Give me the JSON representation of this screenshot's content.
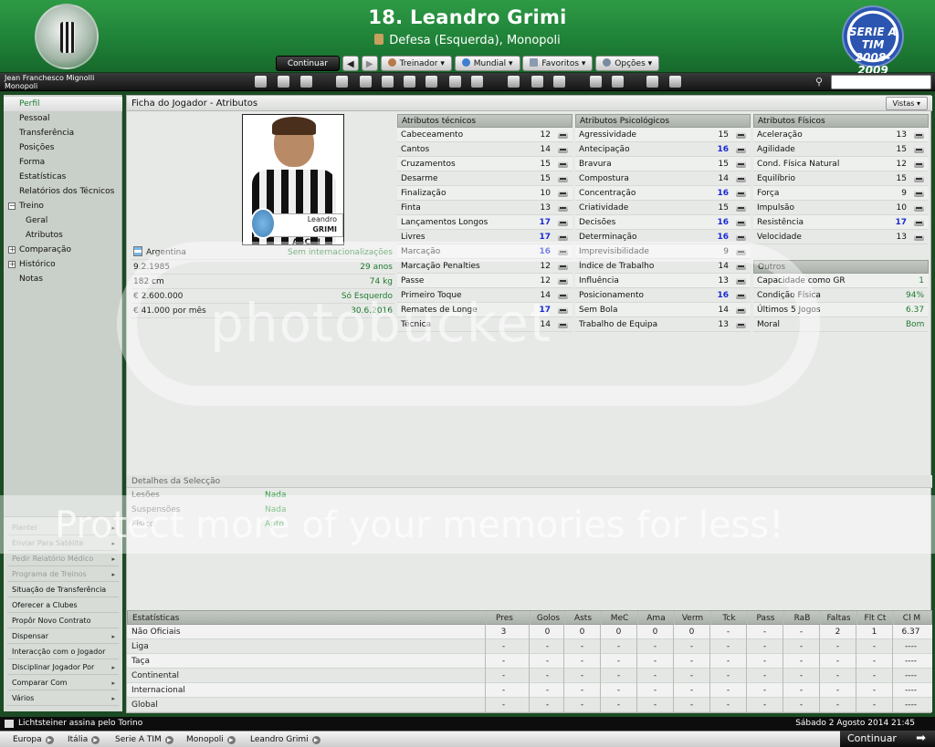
{
  "header": {
    "title": "18. Leandro Grimi",
    "subtitle": "Defesa (Esquerda), Monopoli",
    "continue_label": "Continuar",
    "menus": [
      "Treinador",
      "Mundial",
      "Favoritos",
      "Opções"
    ],
    "right_logo_text": "SERIE A TIM 2008-2009"
  },
  "manager": {
    "name": "Jean Franchesco Mignolli",
    "club": "Monopoli"
  },
  "search": {
    "placeholder": ""
  },
  "sidebar": {
    "items": [
      "Perfil",
      "Pessoal",
      "Transferência",
      "Posições",
      "Forma",
      "Estatísticas",
      "Relatórios dos Técnicos",
      "Treino",
      "Geral",
      "Atributos",
      "Comparação",
      "Histórico",
      "Notas"
    ],
    "actions": [
      "Plantel",
      "Enviar Para Satélite",
      "Pedir Relatório Médico",
      "Programa de Treinos",
      "Situação de Transferência",
      "Oferecer a Clubes",
      "Propôr Novo Contrato",
      "Dispensar",
      "Interacção com o Jogador",
      "Disciplinar Jogador Por",
      "Comparar Com",
      "Vários"
    ]
  },
  "panel": {
    "title": "Ficha do Jogador - Atributos",
    "views_label": "Vistas"
  },
  "player": {
    "card_first": "Leandro",
    "card_last": "GRIMI",
    "sponsor": "ASCHI",
    "nation": "Argentina",
    "internationals": "Sem internacionalizações",
    "dob": "9.2.1985",
    "age": "29 anos",
    "height": "182 cm",
    "weight": "74 kg",
    "value": "€ 2.600.000",
    "foot": "Só Esquerdo",
    "wage": "€ 41.000 por mês",
    "contract": "30.6.2016"
  },
  "technical": {
    "title": "Atributos técnicos",
    "rows": [
      {
        "name": "Cabeceamento",
        "value": "12"
      },
      {
        "name": "Cantos",
        "value": "14"
      },
      {
        "name": "Cruzamentos",
        "value": "15"
      },
      {
        "name": "Desarme",
        "value": "15"
      },
      {
        "name": "Finalização",
        "value": "10"
      },
      {
        "name": "Finta",
        "value": "13"
      },
      {
        "name": "Lançamentos Longos",
        "value": "17"
      },
      {
        "name": "Livres",
        "value": "17"
      },
      {
        "name": "Marcação",
        "value": "16"
      },
      {
        "name": "Marcação Penalties",
        "value": "12"
      },
      {
        "name": "Passe",
        "value": "12"
      },
      {
        "name": "Primeiro Toque",
        "value": "14"
      },
      {
        "name": "Remates de Longe",
        "value": "17"
      },
      {
        "name": "Técnica",
        "value": "14"
      }
    ]
  },
  "mental": {
    "title": "Atributos Psicológicos",
    "rows": [
      {
        "name": "Agressividade",
        "value": "15"
      },
      {
        "name": "Antecipação",
        "value": "16"
      },
      {
        "name": "Bravura",
        "value": "15"
      },
      {
        "name": "Compostura",
        "value": "14"
      },
      {
        "name": "Concentração",
        "value": "16"
      },
      {
        "name": "Criatividade",
        "value": "15"
      },
      {
        "name": "Decisões",
        "value": "16"
      },
      {
        "name": "Determinação",
        "value": "16"
      },
      {
        "name": "Imprevisibilidade",
        "value": "9"
      },
      {
        "name": "Índice de Trabalho",
        "value": "14"
      },
      {
        "name": "Influência",
        "value": "13"
      },
      {
        "name": "Posicionamento",
        "value": "16"
      },
      {
        "name": "Sem Bola",
        "value": "14"
      },
      {
        "name": "Trabalho de Equipa",
        "value": "13"
      }
    ]
  },
  "physical": {
    "title": "Atributos Físicos",
    "rows": [
      {
        "name": "Aceleração",
        "value": "13"
      },
      {
        "name": "Agilidade",
        "value": "15"
      },
      {
        "name": "Cond. Física Natural",
        "value": "12"
      },
      {
        "name": "Equilíbrio",
        "value": "15"
      },
      {
        "name": "Força",
        "value": "9"
      },
      {
        "name": "Impulsão",
        "value": "10"
      },
      {
        "name": "Resistência",
        "value": "17"
      },
      {
        "name": "Velocidade",
        "value": "13"
      }
    ]
  },
  "others": {
    "title": "Outros",
    "rows": [
      {
        "name": "Capacidade como GR",
        "value": "1"
      },
      {
        "name": "Condição Física",
        "value": "94%"
      },
      {
        "name": "Últimos 5 Jogos",
        "value": "6.37"
      },
      {
        "name": "Moral",
        "value": "Bom"
      }
    ]
  },
  "selection": {
    "title": "Detalhes da Selecção",
    "rows": [
      {
        "name": "Lesões",
        "value": "Nada"
      },
      {
        "name": "Suspensões",
        "value": "Nada"
      },
      {
        "name": "Físico",
        "value": "Apto"
      }
    ]
  },
  "stats": {
    "title": "Estatísticas",
    "columns": [
      "Pres",
      "Golos",
      "Asts",
      "MeC",
      "Ama",
      "Verm",
      "Tck",
      "Pass",
      "RaB",
      "Faltas",
      "Flt Ct",
      "Cl M"
    ],
    "rows": [
      {
        "label": "Não Oficiais",
        "cells": [
          "3",
          "0",
          "0",
          "0",
          "0",
          "0",
          "-",
          "-",
          "-",
          "2",
          "1",
          "6.37"
        ]
      },
      {
        "label": "Liga",
        "cells": [
          "-",
          "-",
          "-",
          "-",
          "-",
          "-",
          "-",
          "-",
          "-",
          "-",
          "-",
          "----"
        ]
      },
      {
        "label": "Taça",
        "cells": [
          "-",
          "-",
          "-",
          "-",
          "-",
          "-",
          "-",
          "-",
          "-",
          "-",
          "-",
          "----"
        ]
      },
      {
        "label": "Continental",
        "cells": [
          "-",
          "-",
          "-",
          "-",
          "-",
          "-",
          "-",
          "-",
          "-",
          "-",
          "-",
          "----"
        ]
      },
      {
        "label": "Internacional",
        "cells": [
          "-",
          "-",
          "-",
          "-",
          "-",
          "-",
          "-",
          "-",
          "-",
          "-",
          "-",
          "----"
        ]
      },
      {
        "label": "Global",
        "cells": [
          "-",
          "-",
          "-",
          "-",
          "-",
          "-",
          "-",
          "-",
          "-",
          "-",
          "-",
          "----"
        ]
      }
    ]
  },
  "footer": {
    "news": "Lichtsteiner assina pelo Torino",
    "datetime": "Sábado 2 Agosto 2014 21:45",
    "breadcrumbs": [
      "Europa",
      "Itália",
      "Serie A TIM",
      "Monopoli",
      "Leandro Grimi"
    ],
    "continue_label": "Continuar"
  },
  "watermark": {
    "logo": "photobucket",
    "tagline": "Protect more of your memories for less!"
  },
  "colors": {
    "header_green": "#1f8238",
    "value_highlight": "#1a2bd6",
    "positive_text": "#1e7a2e"
  }
}
